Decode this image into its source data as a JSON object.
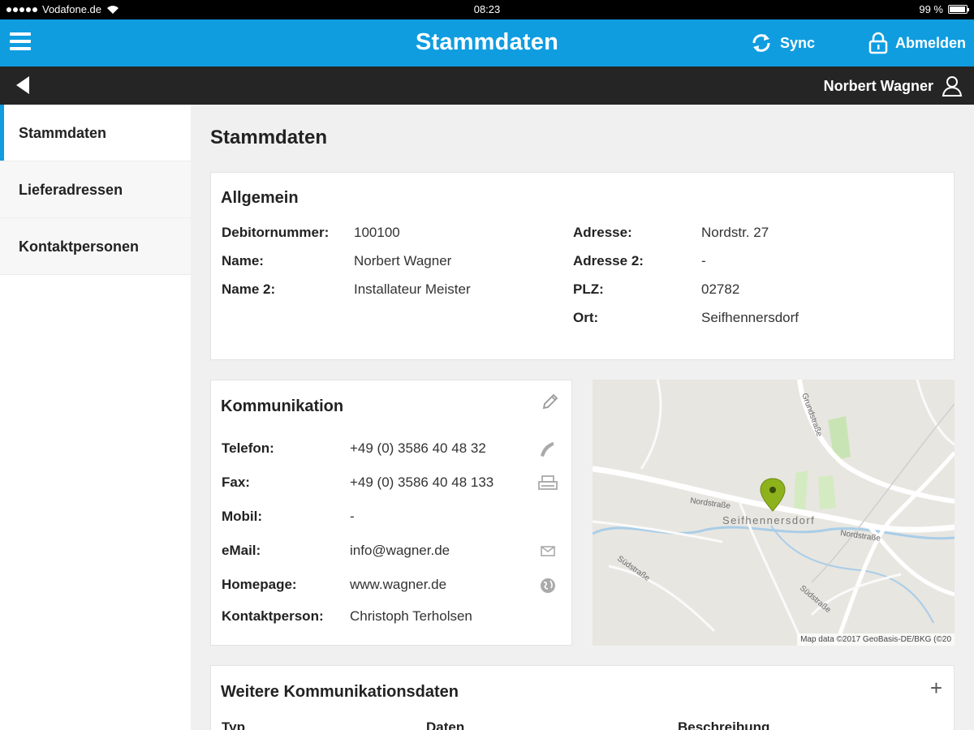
{
  "statusbar": {
    "carrier": "Vodafone.de",
    "time": "08:23",
    "battery": "99 %"
  },
  "header": {
    "title": "Stammdaten",
    "sync_label": "Sync",
    "logout_label": "Abmelden",
    "accent_color": "#0f9de0"
  },
  "subbar": {
    "user_name": "Norbert Wagner"
  },
  "sidebar": {
    "items": [
      {
        "label": "Stammdaten",
        "active": true
      },
      {
        "label": "Lieferadressen",
        "active": false
      },
      {
        "label": "Kontaktpersonen",
        "active": false
      }
    ]
  },
  "main": {
    "title": "Stammdaten",
    "allgemein": {
      "heading": "Allgemein",
      "left": [
        {
          "label": "Debitornummer:",
          "value": "100100"
        },
        {
          "label": "Name:",
          "value": "Norbert Wagner"
        },
        {
          "label": "Name 2:",
          "value": "Installateur Meister"
        }
      ],
      "right": [
        {
          "label": "Adresse:",
          "value": "Nordstr. 27"
        },
        {
          "label": "Adresse 2:",
          "value": "-"
        },
        {
          "label": "PLZ:",
          "value": "02782"
        },
        {
          "label": "Ort:",
          "value": "Seifhennersdorf"
        }
      ]
    },
    "kommunikation": {
      "heading": "Kommunikation",
      "rows": [
        {
          "label": "Telefon:",
          "value": "+49 (0) 3586 40 48 32",
          "icon": "phone-icon"
        },
        {
          "label": "Fax:",
          "value": "+49 (0) 3586 40 48 133",
          "icon": "printer-icon"
        },
        {
          "label": "Mobil:",
          "value": "-",
          "icon": ""
        },
        {
          "label": "eMail:",
          "value": "info@wagner.de",
          "icon": "mail-icon"
        },
        {
          "label": "Homepage:",
          "value": "www.wagner.de",
          "icon": "globe-icon"
        },
        {
          "label": "Kontaktperson:",
          "value": "Christoph Terholsen",
          "icon": ""
        }
      ]
    },
    "map": {
      "town_label": "Seifhennersdorf",
      "street_labels": [
        "Nordstraße",
        "Nordstraße",
        "Südstraße",
        "Südstraße",
        "Grundstraße"
      ],
      "attribution": "Map data ©2017 GeoBasis-DE/BKG (©20"
    },
    "weitere": {
      "heading": "Weitere Kommunikationsdaten",
      "columns": [
        "Typ",
        "Daten",
        "Beschreibung"
      ]
    }
  }
}
